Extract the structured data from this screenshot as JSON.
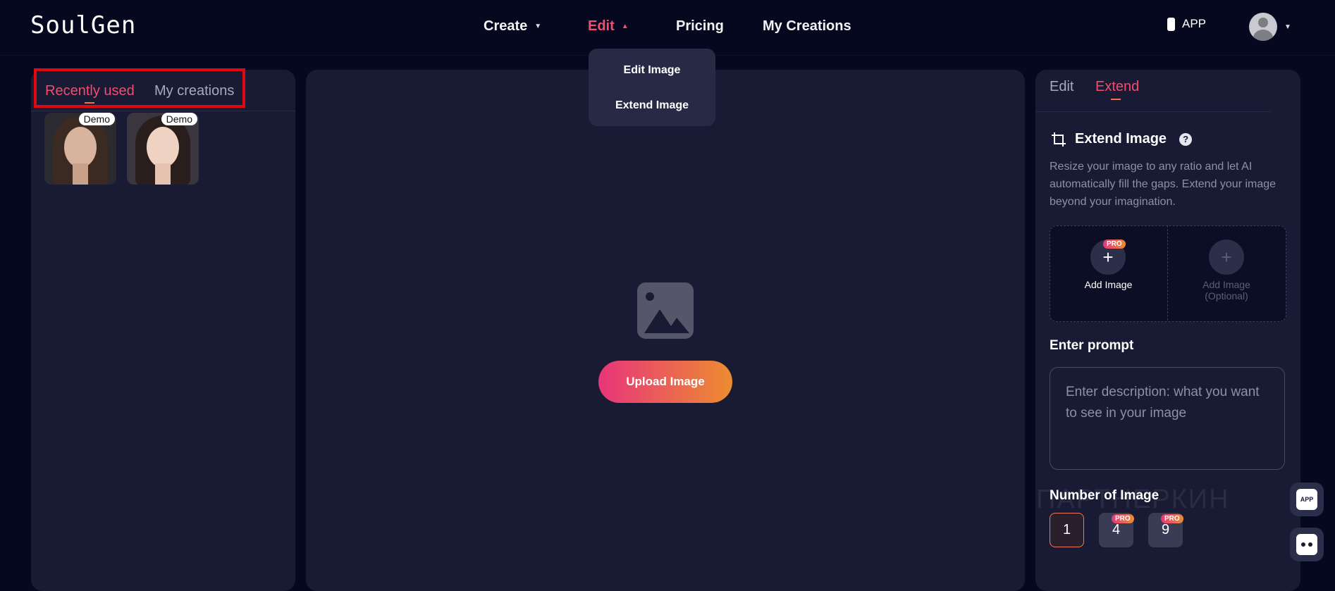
{
  "header": {
    "logo": "SoulGen",
    "nav": [
      {
        "label": "Create"
      },
      {
        "label": "Edit"
      },
      {
        "label": "Pricing"
      },
      {
        "label": "My Creations"
      }
    ],
    "app_label": "APP"
  },
  "edit_dropdown": {
    "items": [
      "Edit Image",
      "Extend Image"
    ]
  },
  "left_panel": {
    "tabs": [
      "Recently used",
      "My creations"
    ],
    "thumbnails": [
      {
        "badge": "Demo"
      },
      {
        "badge": "Demo"
      }
    ]
  },
  "center": {
    "upload_label": "Upload Image"
  },
  "right_panel": {
    "tabs": [
      "Edit",
      "Extend"
    ],
    "section_title": "Extend Image",
    "help": "?",
    "description": "Resize your image to any ratio and let AI automatically fill the gaps. Extend your image beyond your imagination.",
    "add_image": {
      "label": "Add Image",
      "badge": "PRO"
    },
    "add_image_optional": {
      "label_line1": "Add Image",
      "label_line2": "(Optional)"
    },
    "prompt_title": "Enter prompt",
    "prompt_placeholder": "Enter description: what you want to see in your image",
    "number_title": "Number of Image",
    "number_options": [
      {
        "value": "1",
        "badge": ""
      },
      {
        "value": "4",
        "badge": "PRO"
      },
      {
        "value": "9",
        "badge": "PRO"
      }
    ],
    "watermark": "ПАРТНЕРКИН"
  },
  "floating": {
    "app_badge": "APP"
  },
  "colors": {
    "accent_pink": "#f04d6f",
    "accent_orange": "#ec8c30",
    "background": "#05081f",
    "panel": "#191a33",
    "highlight_red": "#e00812"
  }
}
